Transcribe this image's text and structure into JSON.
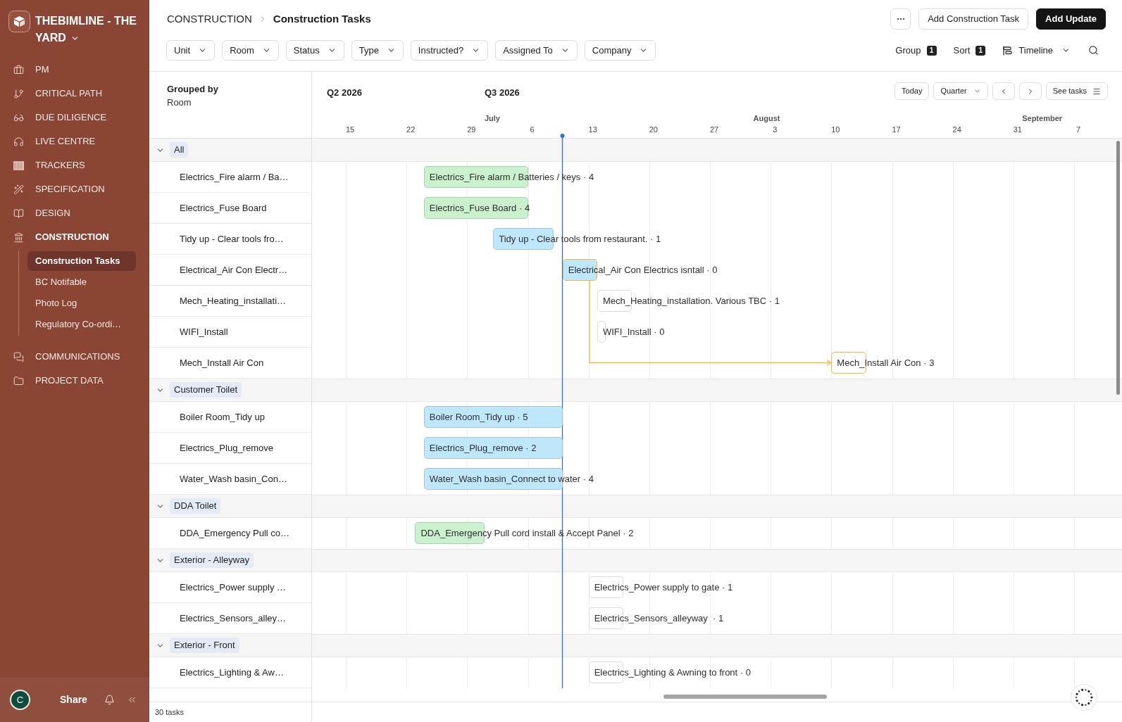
{
  "sidebar": {
    "workspace": "THEBIMLINE - THE YARD",
    "nav": [
      {
        "label": "PM",
        "selected": false
      },
      {
        "label": "CRITICAL PATH",
        "selected": false
      },
      {
        "label": "DUE DILIGENCE",
        "selected": false
      },
      {
        "label": "LIVE CENTRE",
        "selected": false
      },
      {
        "label": "TRACKERS",
        "selected": false
      },
      {
        "label": "SPECIFICATION",
        "selected": false
      },
      {
        "label": "DESIGN",
        "selected": false
      },
      {
        "label": "CONSTRUCTION",
        "selected": true,
        "children": [
          {
            "label": "Construction Tasks",
            "selected": true
          },
          {
            "label": "BC Notifable",
            "selected": false
          },
          {
            "label": "Photo Log",
            "selected": false
          },
          {
            "label": "Regulatory Co-ordi…",
            "selected": false
          }
        ]
      },
      {
        "label": "COMMUNICATIONS",
        "selected": false
      },
      {
        "label": "PROJECT DATA",
        "selected": false
      }
    ],
    "avatar": "C",
    "share": "Share"
  },
  "breadcrumb": [
    "CONSTRUCTION",
    "Construction Tasks"
  ],
  "actions": [
    {
      "label": "Add Construction Task",
      "kind": "secondary"
    },
    {
      "label": "Add Update",
      "kind": "primary"
    }
  ],
  "filters": [
    "Unit",
    "Room",
    "Status",
    "Type",
    "Instructed?",
    "Assigned To",
    "Company"
  ],
  "view_controls": {
    "group": {
      "label": "Group",
      "count": "1"
    },
    "sort": {
      "label": "Sort",
      "count": "1"
    },
    "layout": "Timeline"
  },
  "list": {
    "grouped_by_title": "Grouped by",
    "grouped_by": "Room",
    "footer": "30 tasks"
  },
  "timeline": {
    "quarters": [
      "Q2 2026",
      "Q3 2026"
    ],
    "months": [
      "July",
      "August",
      "September"
    ],
    "weeks": [
      "15",
      "22",
      "29",
      "6",
      "13",
      "20",
      "27",
      "3",
      "10",
      "17",
      "24",
      "31",
      "7"
    ],
    "today_button": "Today",
    "scale": "Quarter",
    "see_tasks": "See tasks"
  },
  "groups": [
    {
      "label": "All",
      "expanded": true,
      "tasks": [
        {
          "name": "Electrics_Fire alarm / Ba…",
          "bar_label": "Electrics_Fire alarm / Batteries / keys · 4",
          "color": "#c9f1cd",
          "highlighted": false
        },
        {
          "name": "Electrics_Fuse Board",
          "bar_label": "Electrics_Fuse Board · 4",
          "color": "#c9f1cd",
          "highlighted": false
        },
        {
          "name": "Tidy up - Clear tools fro…",
          "bar_label": "Tidy up - Clear tools from restaurant. · 1",
          "color": "#bfe7fb",
          "highlighted": false
        },
        {
          "name": "Electrical_Air Con Electr…",
          "bar_label": "Electrical_Air Con Electrics isntall · 0",
          "color": "#bfe7fb",
          "highlighted": true
        },
        {
          "name": "Mech_Heating_installati…",
          "bar_label": "Mech_Heating_installation. Various TBC · 1",
          "color": "#ffffff",
          "highlighted": false
        },
        {
          "name": "WIFI_Install",
          "bar_label": "WIFI_Install · 0",
          "color": "#ffffff",
          "highlighted": false
        },
        {
          "name": "Mech_Install Air Con",
          "bar_label": "Mech_Install Air Con · 3",
          "color": "#ffffff",
          "highlighted": true
        }
      ]
    },
    {
      "label": "Customer Toilet",
      "expanded": true,
      "tasks": [
        {
          "name": "Boiler Room_Tidy up",
          "bar_label": "Boiler Room_Tidy up · 5",
          "color": "#bfe7fb",
          "highlighted": false
        },
        {
          "name": "Electrics_Plug_remove",
          "bar_label": "Electrics_Plug_remove · 2",
          "color": "#bfe7fb",
          "highlighted": false
        },
        {
          "name": "Water_Wash basin_Con…",
          "bar_label": "Water_Wash basin_Connect to water · 4",
          "color": "#bfe7fb",
          "highlighted": false
        }
      ]
    },
    {
      "label": "DDA Toilet",
      "expanded": true,
      "tasks": [
        {
          "name": "DDA_Emergency Pull co…",
          "bar_label": "DDA_Emergency Pull cord install & Accept Panel · 2",
          "color": "#c9f1cd",
          "highlighted": false
        }
      ]
    },
    {
      "label": "Exterior - Alleyway",
      "expanded": true,
      "tasks": [
        {
          "name": "Electrics_Power supply …",
          "bar_label": "Electrics_Power supply to gate · 1",
          "color": "#ffffff",
          "highlighted": false
        },
        {
          "name": "Electrics_Sensors_alley…",
          "bar_label": "Electrics_Sensors_alleyway  · 1",
          "color": "#ffffff",
          "highlighted": false
        }
      ]
    },
    {
      "label": "Exterior - Front",
      "expanded": true,
      "tasks": [
        {
          "name": "Electrics_Lighting & Aw…",
          "bar_label": "Electrics_Lighting & Awning to front · 0",
          "color": "#ffffff",
          "highlighted": false
        }
      ]
    }
  ]
}
